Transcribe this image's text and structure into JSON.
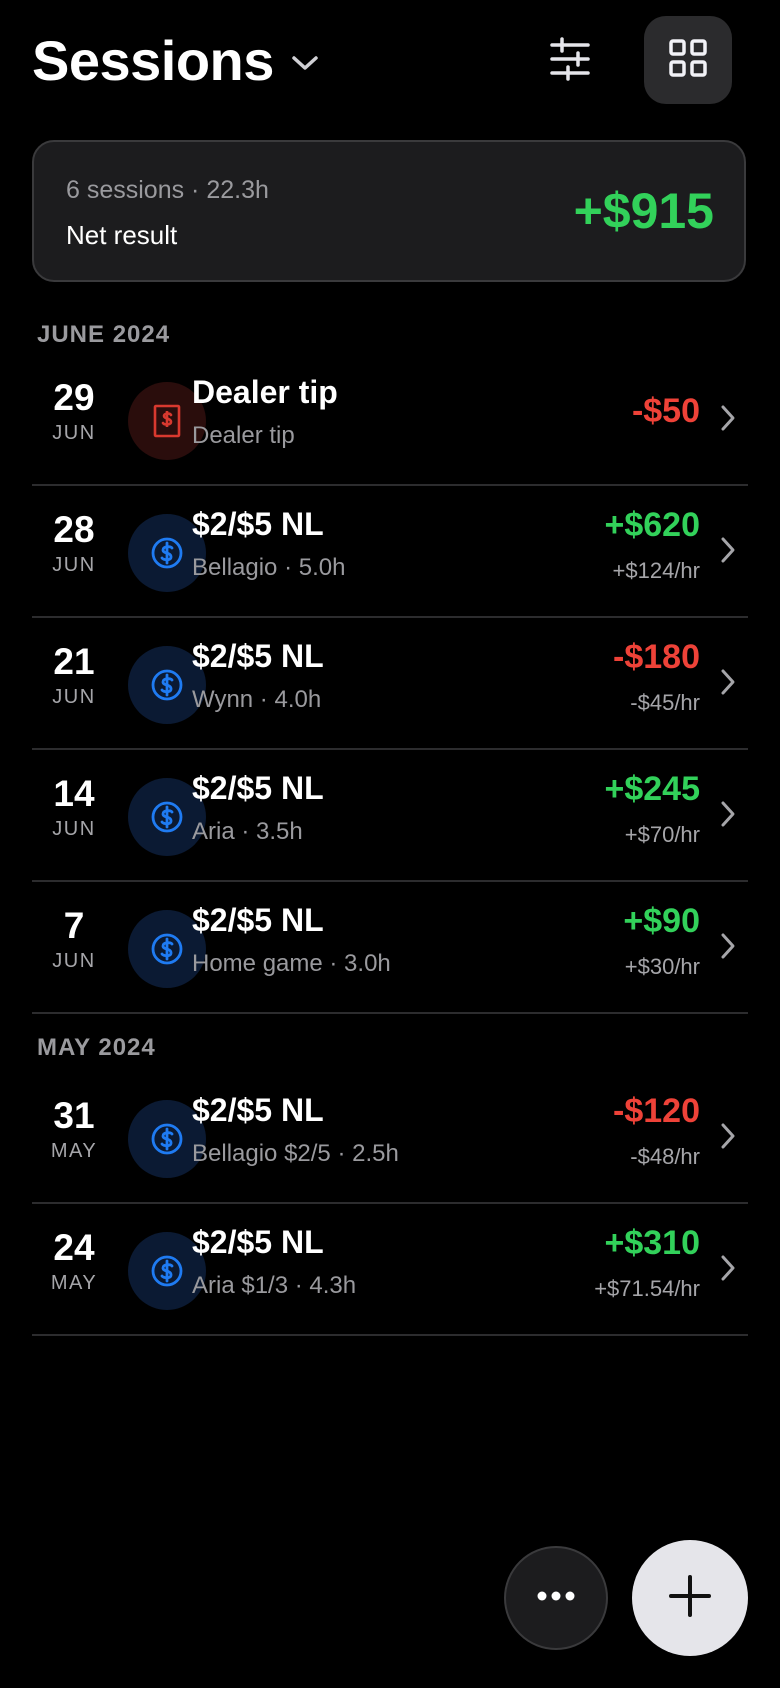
{
  "header": {
    "title": "Sessions",
    "title_dropdown_icon": "chevron-down-icon",
    "filter_icon": "sliders-icon",
    "view_toggle_icon": "grid-icon"
  },
  "summary": {
    "meta": "6 sessions · 22.3h",
    "label": "Net result",
    "value": "+$915"
  },
  "sections": [
    {
      "title": "JUNE 2024"
    },
    {
      "title": "MAY 2024"
    }
  ],
  "rows": [
    {
      "day": "29",
      "month": "JUN",
      "icon": "receipt-dollar-icon",
      "title": "Dealer tip",
      "subtitle": "Dealer tip",
      "amount": "-$50",
      "rate": ""
    },
    {
      "day": "28",
      "month": "JUN",
      "icon": "dollar-circle-icon",
      "title": "$2/$5 NL",
      "subtitle": "Bellagio · 5.0h",
      "amount": "+$620",
      "rate": "+$124/hr"
    },
    {
      "day": "21",
      "month": "JUN",
      "icon": "dollar-circle-icon",
      "title": "$2/$5 NL",
      "subtitle": "Wynn · 4.0h",
      "amount": "-$180",
      "rate": "-$45/hr"
    },
    {
      "day": "14",
      "month": "JUN",
      "icon": "dollar-circle-icon",
      "title": "$2/$5 NL",
      "subtitle": "Aria · 3.5h",
      "amount": "+$245",
      "rate": "+$70/hr"
    },
    {
      "day": "7",
      "month": "JUN",
      "icon": "dollar-circle-icon",
      "title": "$2/$5 NL",
      "subtitle": "Home game · 3.0h",
      "amount": "+$90",
      "rate": "+$30/hr"
    },
    {
      "day": "31",
      "month": "MAY",
      "icon": "dollar-circle-icon",
      "title": "$2/$5 NL",
      "subtitle": "Bellagio $2/5 · 2.5h",
      "amount": "-$120",
      "rate": "-$48/hr"
    },
    {
      "day": "24",
      "month": "MAY",
      "icon": "dollar-circle-icon",
      "title": "$2/$5 NL",
      "subtitle": "Aria $1/3 · 4.3h",
      "amount": "+$310",
      "rate": "+$71.54/hr"
    }
  ],
  "fab": {
    "more_icon": "ellipsis-icon",
    "add_icon": "plus-icon"
  },
  "colors": {
    "positive": "#32d15a",
    "negative": "#ee4238",
    "accent_blue": "#1f7bf2",
    "tip_red": "#d8392f"
  }
}
